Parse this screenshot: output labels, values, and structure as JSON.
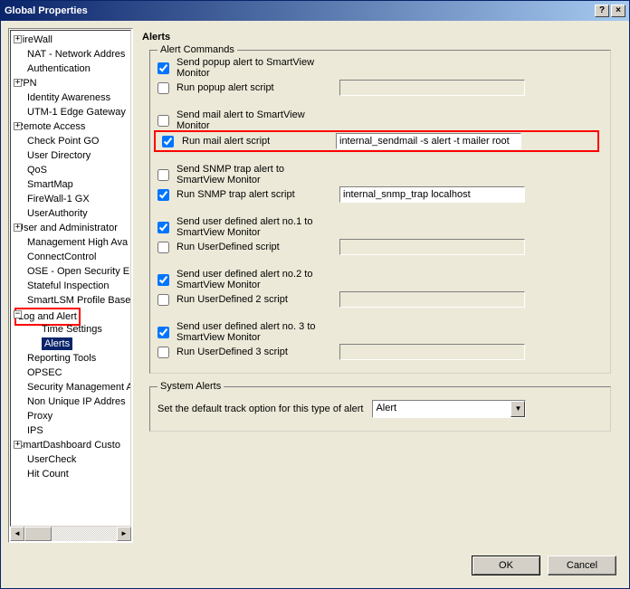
{
  "window_title": "Global Properties",
  "tree": [
    {
      "label": "FireWall",
      "lvl": 0,
      "exp": "+"
    },
    {
      "label": "NAT - Network Addres",
      "lvl": 1
    },
    {
      "label": "Authentication",
      "lvl": 1
    },
    {
      "label": "VPN",
      "lvl": 0,
      "exp": "+"
    },
    {
      "label": "Identity Awareness",
      "lvl": 1
    },
    {
      "label": "UTM-1 Edge Gateway",
      "lvl": 1
    },
    {
      "label": "Remote Access",
      "lvl": 0,
      "exp": "+"
    },
    {
      "label": "Check Point GO",
      "lvl": 1
    },
    {
      "label": "User Directory",
      "lvl": 1
    },
    {
      "label": "QoS",
      "lvl": 1
    },
    {
      "label": "SmartMap",
      "lvl": 1
    },
    {
      "label": "FireWall-1 GX",
      "lvl": 1
    },
    {
      "label": "UserAuthority",
      "lvl": 1
    },
    {
      "label": "User and Administrator",
      "lvl": 0,
      "exp": "+"
    },
    {
      "label": "Management High Ava",
      "lvl": 1
    },
    {
      "label": "ConnectControl",
      "lvl": 1
    },
    {
      "label": "OSE - Open Security E",
      "lvl": 1
    },
    {
      "label": "Stateful Inspection",
      "lvl": 1
    },
    {
      "label": "SmartLSM Profile Base",
      "lvl": 1
    },
    {
      "label": "Log and Alert",
      "lvl": 0,
      "exp": "−",
      "red": true
    },
    {
      "label": "Time Settings",
      "lvl": 2
    },
    {
      "label": "Alerts",
      "lvl": 2,
      "selected": true
    },
    {
      "label": "Reporting Tools",
      "lvl": 1
    },
    {
      "label": "OPSEC",
      "lvl": 1
    },
    {
      "label": "Security Management A",
      "lvl": 1
    },
    {
      "label": "Non Unique IP Addres",
      "lvl": 1
    },
    {
      "label": "Proxy",
      "lvl": 1
    },
    {
      "label": "IPS",
      "lvl": 1
    },
    {
      "label": "SmartDashboard Custo",
      "lvl": 0,
      "exp": "+"
    },
    {
      "label": "UserCheck",
      "lvl": 1
    },
    {
      "label": "Hit Count",
      "lvl": 1
    }
  ],
  "page_heading": "Alerts",
  "alert_commands": {
    "legend": "Alert Commands",
    "popup_send": {
      "label": "Send popup alert to SmartView Monitor",
      "checked": true
    },
    "popup_run": {
      "label": "Run popup alert script",
      "checked": false,
      "value": ""
    },
    "mail_send": {
      "label": "Send mail alert to SmartView Monitor",
      "checked": false
    },
    "mail_run": {
      "label": "Run mail alert script",
      "checked": true,
      "value": "internal_sendmail -s alert -t mailer root"
    },
    "snmp_send": {
      "label": "Send SNMP trap alert to SmartView Monitor",
      "checked": false
    },
    "snmp_run": {
      "label": "Run SNMP trap alert script",
      "checked": true,
      "value": "internal_snmp_trap localhost"
    },
    "ud1_send": {
      "label": "Send user defined alert no.1 to SmartView Monitor",
      "checked": true
    },
    "ud1_run": {
      "label": "Run UserDefined script",
      "checked": false,
      "value": ""
    },
    "ud2_send": {
      "label": "Send user defined alert no.2 to SmartView Monitor",
      "checked": true
    },
    "ud2_run": {
      "label": "Run UserDefined 2 script",
      "checked": false,
      "value": ""
    },
    "ud3_send": {
      "label": "Send user defined alert no. 3 to SmartView Monitor",
      "checked": true
    },
    "ud3_run": {
      "label": "Run UserDefined 3 script",
      "checked": false,
      "value": ""
    }
  },
  "system_alerts": {
    "legend": "System Alerts",
    "label": "Set the default track option for this type of alert",
    "value": "Alert"
  },
  "buttons": {
    "ok": "OK",
    "cancel": "Cancel"
  }
}
